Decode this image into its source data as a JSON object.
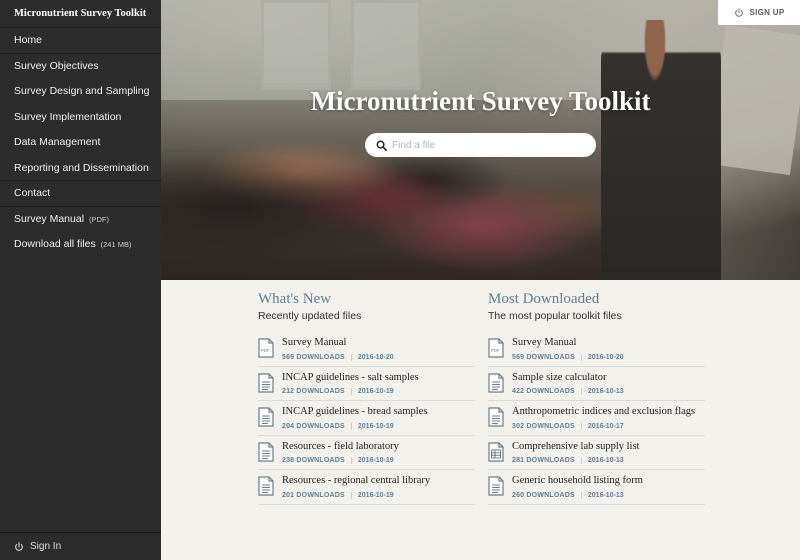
{
  "sidebar": {
    "brand": "Micronutrient Survey Toolkit",
    "items": [
      {
        "label": "Home"
      },
      {
        "label": "Survey Objectives"
      },
      {
        "label": "Survey Design and Sampling"
      },
      {
        "label": "Survey Implementation"
      },
      {
        "label": "Data Management"
      },
      {
        "label": "Reporting and Dissemination"
      },
      {
        "label": "Contact"
      },
      {
        "label": "Survey Manual",
        "meta": "(PDF)"
      },
      {
        "label": "Download all files",
        "meta": "(241 MB)"
      }
    ],
    "signin": "Sign In"
  },
  "hero": {
    "title": "Micronutrient Survey Toolkit",
    "search_placeholder": "Find a file",
    "signup": "SIGN UP"
  },
  "whats_new": {
    "heading": "What's New",
    "subheading": "Recently updated files",
    "files": [
      {
        "name": "Survey Manual",
        "downloads": "569 DOWNLOADS",
        "date": "2016-10-20",
        "icon": "pdf-icon"
      },
      {
        "name": "INCAP guidelines - salt samples",
        "downloads": "212 DOWNLOADS",
        "date": "2016-10-19",
        "icon": "document-icon"
      },
      {
        "name": "INCAP guidelines - bread samples",
        "downloads": "204 DOWNLOADS",
        "date": "2016-10-19",
        "icon": "document-icon"
      },
      {
        "name": "Resources - field laboratory",
        "downloads": "238 DOWNLOADS",
        "date": "2016-10-19",
        "icon": "document-icon"
      },
      {
        "name": "Resources - regional central library",
        "downloads": "201 DOWNLOADS",
        "date": "2016-10-19",
        "icon": "document-icon"
      }
    ]
  },
  "most_downloaded": {
    "heading": "Most Downloaded",
    "subheading": "The most popular toolkit files",
    "files": [
      {
        "name": "Survey Manual",
        "downloads": "569 DOWNLOADS",
        "date": "2016-10-20",
        "icon": "pdf-icon"
      },
      {
        "name": "Sample size calculator",
        "downloads": "422 DOWNLOADS",
        "date": "2016-10-13",
        "icon": "document-icon"
      },
      {
        "name": "Anthropometric indices and exclusion flags",
        "downloads": "302 DOWNLOADS",
        "date": "2016-10-17",
        "icon": "document-icon"
      },
      {
        "name": "Comprehensive lab supply list",
        "downloads": "281 DOWNLOADS",
        "date": "2016-10-13",
        "icon": "spreadsheet-icon"
      },
      {
        "name": "Generic household listing form",
        "downloads": "260 DOWNLOADS",
        "date": "2016-10-13",
        "icon": "document-icon"
      }
    ]
  },
  "colors": {
    "sidebar_bg": "#2c2c2c",
    "accent": "#5f7f97",
    "content_bg": "#f3f1ec"
  }
}
